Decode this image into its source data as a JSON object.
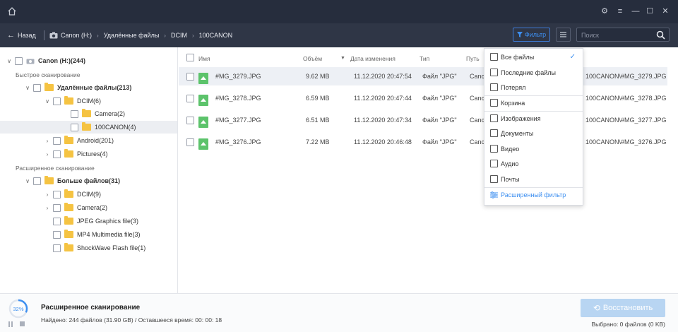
{
  "titlebar": {
    "controls": [
      "settings",
      "menu",
      "minimize",
      "maximize",
      "close"
    ]
  },
  "nav": {
    "back_label": "Назад",
    "breadcrumbs": [
      "Canon (H:)",
      "Удалённые файлы",
      "DCIM",
      "100CANON"
    ],
    "filter_label": "Фильтр",
    "search_placeholder": "Поиск"
  },
  "tree": {
    "root": "Canon (H:)(244)",
    "quick_scan_label": "Быстрое сканирование",
    "deleted_files": "Удалённые файлы(213)",
    "dcim": "DCIM(6)",
    "camera": "Camera(2)",
    "canon100": "100CANON(4)",
    "android": "Android(201)",
    "pictures": "Pictures(4)",
    "advanced_scan_label": "Расширенное сканирование",
    "more_files": "Больше файлов(31)",
    "dcim9": "DCIM(9)",
    "camera2": "Camera(2)",
    "jpeg": "JPEG Graphics file(3)",
    "mp4": "MP4 Multimedia file(3)",
    "swf": "ShockWave Flash file(1)"
  },
  "table": {
    "headers": {
      "name": "Имя",
      "size": "Объём",
      "date": "Дата изменения",
      "type": "Тип",
      "path": "Путь"
    },
    "rows": [
      {
        "name": "#MG_3279.JPG",
        "size": "9.62 MB",
        "date": "11.12.2020 20:47:54",
        "type": "Файл \"JPG\"",
        "path_start": "Canc",
        "path_end": "100CANON\\#MG_3279.JPG"
      },
      {
        "name": "#MG_3278.JPG",
        "size": "6.59 MB",
        "date": "11.12.2020 20:47:44",
        "type": "Файл \"JPG\"",
        "path_start": "Canc",
        "path_end": "100CANON\\#MG_3278.JPG"
      },
      {
        "name": "#MG_3277.JPG",
        "size": "6.51 MB",
        "date": "11.12.2020 20:47:34",
        "type": "Файл \"JPG\"",
        "path_start": "Canc",
        "path_end": "100CANON\\#MG_3277.JPG"
      },
      {
        "name": "#MG_3276.JPG",
        "size": "7.22 MB",
        "date": "11.12.2020 20:46:48",
        "type": "Файл \"JPG\"",
        "path_start": "Canc",
        "path_end": "100CANON\\#MG_3276.JPG"
      }
    ]
  },
  "filter_menu": {
    "all_files": "Все файлы",
    "recent_files": "Последние файлы",
    "lost": "Потерял",
    "recycle": "Корзина",
    "images": "Изображения",
    "documents": "Документы",
    "video": "Видео",
    "audio": "Аудио",
    "mail": "Почты",
    "advanced_filter": "Расширенный фильтр"
  },
  "status": {
    "progress_percent": 32,
    "progress_label": "32%",
    "title": "Расширенное сканирование",
    "details": "Найдено: 244 файлов (31.90 GB) / Оставшееся время: 00: 00: 18",
    "restore_label": "Восстановить",
    "selected": "Выбрано: 0 файлов (0 KB)"
  },
  "colors": {
    "titlebar": "#262d3d",
    "navbar": "#2f3646",
    "accent": "#3d8ff0",
    "restore_disabled": "#b8d5f2",
    "folder": "#f5c342",
    "image_file": "#5cc36b"
  }
}
